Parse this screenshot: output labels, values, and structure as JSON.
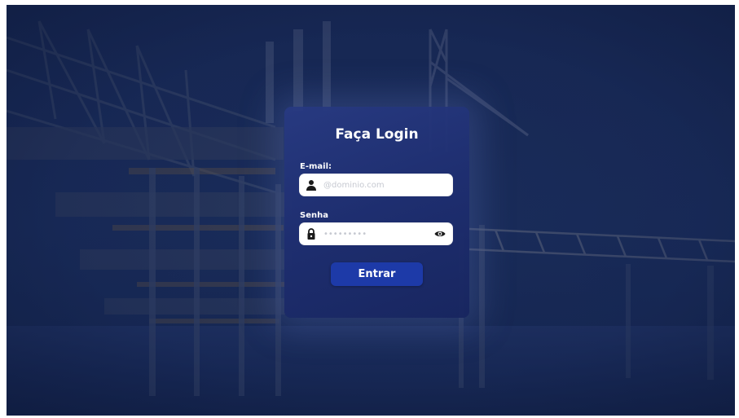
{
  "login": {
    "title": "Faça Login",
    "email_label": "E-mail:",
    "email_placeholder": "@dominio.com",
    "email_icon": "user-icon",
    "password_label": "Senha",
    "password_placeholder": "•••••••••",
    "password_icon": "lock-icon",
    "password_toggle_icon": "eye-icon",
    "submit_label": "Entrar"
  },
  "background": {
    "subject": "offshore-oil-platform-photo",
    "tint": "#1b2f5c"
  },
  "colors": {
    "card": "#263c8a",
    "button": "#1d3aa8",
    "field": "#ffffff",
    "placeholder": "#c6c9d1"
  }
}
